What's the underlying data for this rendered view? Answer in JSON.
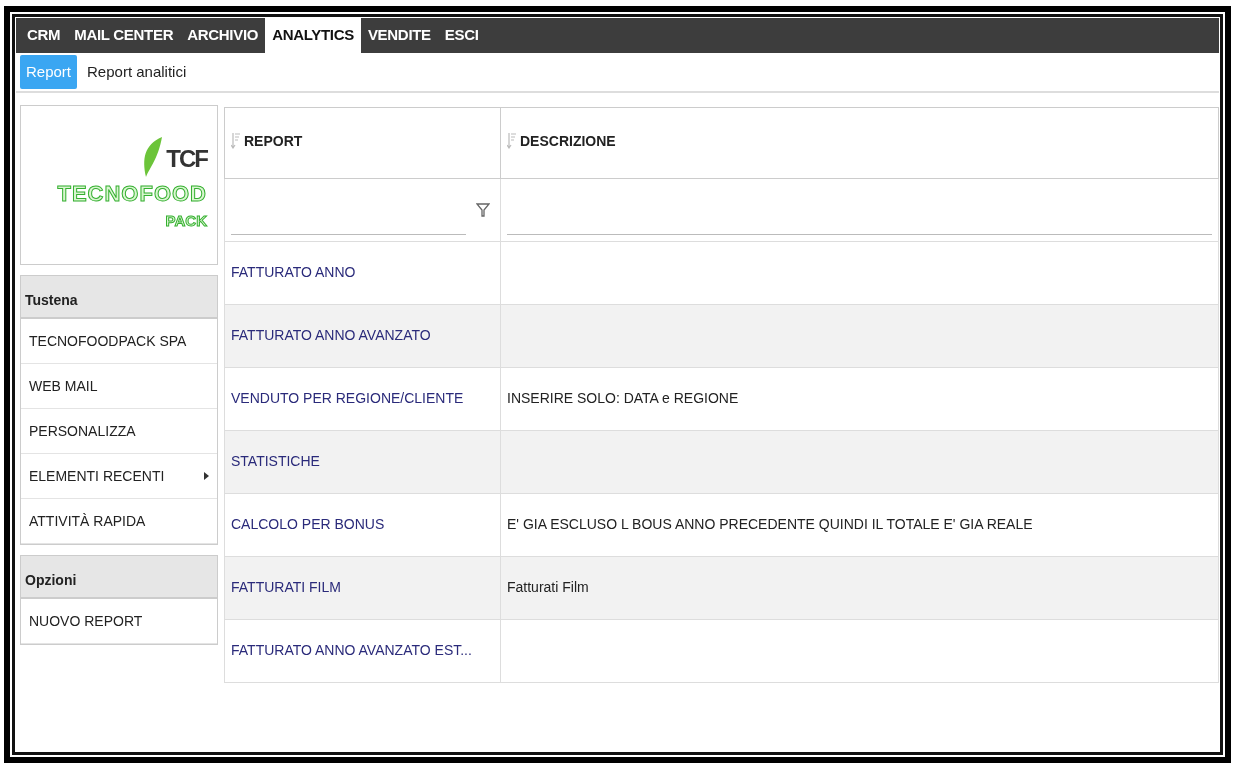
{
  "nav": {
    "tabs": [
      {
        "label": "CRM",
        "selected": false
      },
      {
        "label": "MAIL CENTER",
        "selected": false
      },
      {
        "label": "ARCHIVIO",
        "selected": false
      },
      {
        "label": "ANALYTICS",
        "selected": true
      },
      {
        "label": "VENDITE",
        "selected": false
      },
      {
        "label": "ESCI",
        "selected": false
      }
    ]
  },
  "subnav": {
    "items": [
      {
        "label": "Report",
        "selected": true
      },
      {
        "label": "Report analitici",
        "selected": false
      }
    ]
  },
  "logo": {
    "mark": "TCF",
    "name": "TECNOFOOD",
    "suffix": "PACK"
  },
  "sidebar": {
    "sections": [
      {
        "title": "Tustena",
        "items": [
          {
            "label": "TECNOFOODPACK SPA",
            "submenu": false
          },
          {
            "label": "WEB MAIL",
            "submenu": false
          },
          {
            "label": "PERSONALIZZA",
            "submenu": false
          },
          {
            "label": "ELEMENTI RECENTI",
            "submenu": true
          },
          {
            "label": "ATTIVITÀ RAPIDA",
            "submenu": false
          }
        ]
      },
      {
        "title": "Opzioni",
        "items": [
          {
            "label": "NUOVO REPORT",
            "submenu": false
          }
        ]
      }
    ]
  },
  "table": {
    "columns": [
      "REPORT",
      "DESCRIZIONE"
    ],
    "rows": [
      {
        "report": "FATTURATO ANNO"
      },
      {
        "report": "FATTURATO ANNO AVANZATO"
      },
      {
        "report": "VENDUTO PER REGIONE/CLIENTE",
        "description": "INSERIRE SOLO: DATA e REGIONE"
      },
      {
        "report": "STATISTICHE"
      },
      {
        "report": "CALCOLO PER BONUS",
        "description": "E' GIA ESCLUSO L BOUS ANNO PRECEDENTE QUINDI IL TOTALE E' GIA REALE"
      },
      {
        "report": "FATTURATI FILM",
        "description": "Fatturati Film"
      },
      {
        "report": "FATTURATO ANNO AVANZATO EST..."
      }
    ]
  }
}
